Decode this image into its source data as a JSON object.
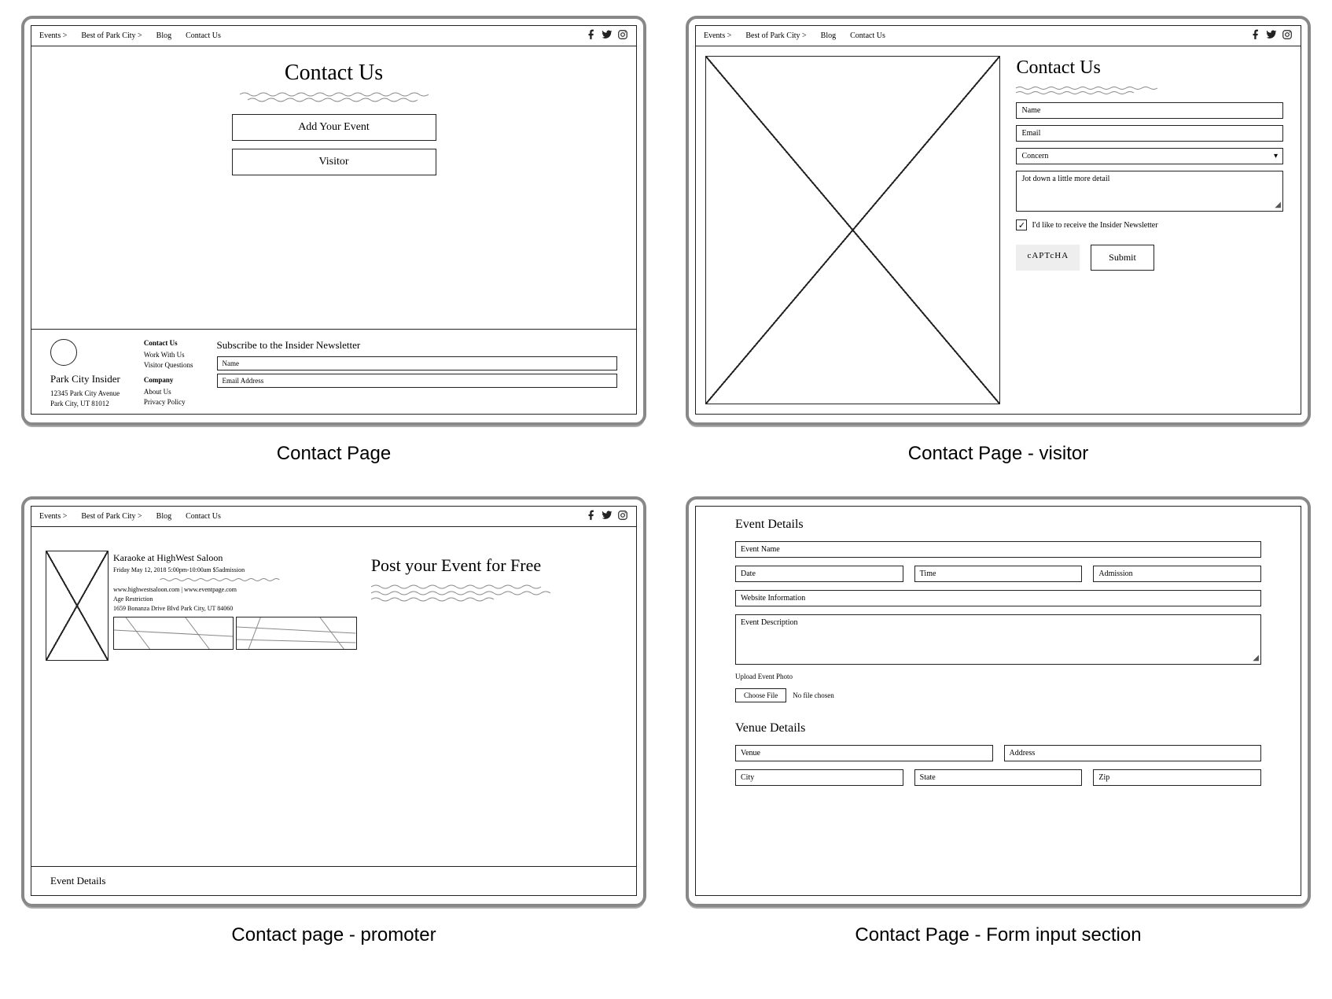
{
  "nav": {
    "items": [
      "Events >",
      "Best of Park City >",
      "Blog",
      "Contact Us"
    ]
  },
  "captions": {
    "p1": "Contact Page",
    "p2": "Contact Page - visitor",
    "p3": "Contact page - promoter",
    "p4": "Contact Page - Form input section"
  },
  "p1": {
    "title": "Contact Us",
    "btn_add": "Add  Your Event",
    "btn_visitor": "Visitor",
    "footer": {
      "brand": "Park City Insider",
      "addr1": "12345 Park City Avenue",
      "addr2": "Park City, UT 81012",
      "col1_hdr": "Contact Us",
      "col1_a": "Work With Us",
      "col1_b": "Visitor Questions",
      "col2_hdr": "Company",
      "col2_a": "About Us",
      "col2_b": "Privacy Policy",
      "sub_hdr": "Subscribe to the Insider Newsletter",
      "sub_name": "Name",
      "sub_email": "Email Address"
    }
  },
  "p2": {
    "title": "Contact Us",
    "ph_name": "Name",
    "ph_email": "Email",
    "sel_concern": "Concern",
    "ph_detail": "Jot down a little more detail",
    "chk_label": "I'd like to receive the Insider Newsletter",
    "captcha": "cAPTcHA",
    "submit": "Submit"
  },
  "p3": {
    "card_title": "Karaoke at HighWest Saloon",
    "card_date": "Friday May 12, 2018   5:00pm-10:00am   $5admission",
    "card_links": "www.highwestsaloon.com   |   www.eventpage.com",
    "card_age": "Age Restriction",
    "card_addr": "1659 Bonanza Drive Blvd Park City, UT 84060",
    "right_title": "Post your Event for Free",
    "bottom_title": "Event Details"
  },
  "p4": {
    "sec1": "Event Details",
    "ph_eventname": "Event Name",
    "ph_date": "Date",
    "ph_time": "Time",
    "ph_admission": "Admission",
    "ph_website": "Website Information",
    "ph_desc": "Event Description",
    "upload_label": "Upload Event Photo",
    "choose_file": "Choose File",
    "no_file": "No file chosen",
    "sec2": "Venue Details",
    "ph_venue": "Venue",
    "ph_address": "Address",
    "ph_city": "City",
    "ph_state": "State",
    "ph_zip": "Zip"
  }
}
